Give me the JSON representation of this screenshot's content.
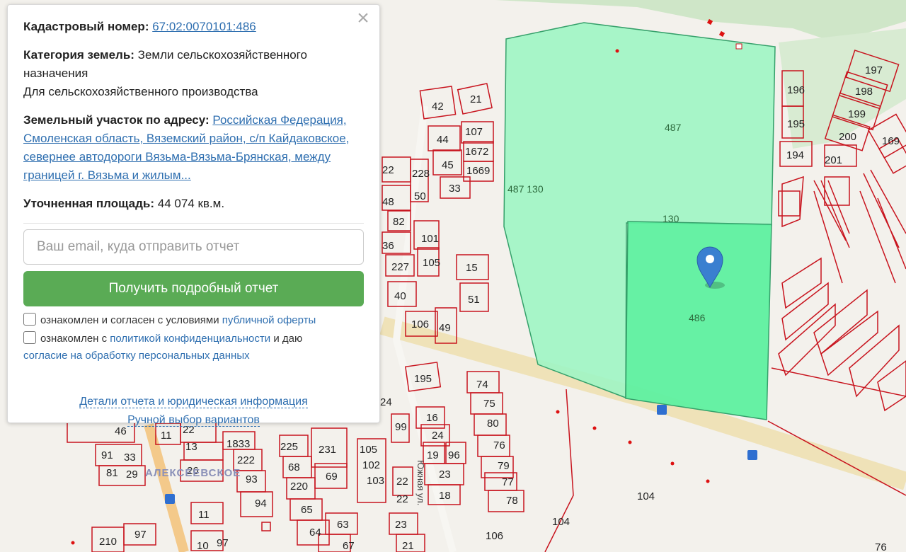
{
  "panel": {
    "close_label": "×",
    "cadastral_label": "Кадастровый номер:",
    "cadastral_value": "67:02:0070101:486",
    "category_label": "Категория земель:",
    "category_value": "Земли сельскохозяйственного назначения",
    "usage": "Для сельскохозяйственного производства",
    "address_label": "Земельный участок по адресу:",
    "address_value": "Российская Федерация, Смоленская область, Вяземский район, с/п Кайдаковское, севернее автодороги Вязьма-Вязьма-Брянская, между границей г. Вязьма и жилым...",
    "area_label": "Уточненная площадь:",
    "area_value": "44 074 кв.м.",
    "email_placeholder": "Ваш email, куда отправить отчет",
    "submit_label": "Получить подробный отчет",
    "check1_text": "ознакомлен и согласен с условиями",
    "check1_link": "публичной оферты",
    "check2_text": "ознакомлен с",
    "check2_link": "политикой конфиденциальности",
    "check2_text2": "и даю",
    "check2_link2": "согласие на обработку персональных данных",
    "footer_link1": "Детали отчета и юридическая информация",
    "footer_link2": "Ручной выбор вариантов"
  },
  "map": {
    "selected_parcel": "486",
    "neighbor_parcel": "487",
    "neighbor_labels": [
      "487 130",
      "130"
    ],
    "selected_color": "#5ef0a0",
    "neighbor_color": "#9ef5c4",
    "boundary_color": "#c8141e",
    "village_label": "АЛЕКСЕЕВСКОЕ",
    "street_labels": [
      "Южная ул."
    ],
    "parcel_numbers": [
      "42",
      "21",
      "44",
      "107",
      "1672",
      "45",
      "1669",
      "33",
      "22",
      "228",
      "50",
      "48",
      "82",
      "36",
      "101",
      "227",
      "105",
      "15",
      "40",
      "51",
      "106",
      "49",
      "195",
      "74",
      "75",
      "80",
      "76",
      "79",
      "77",
      "78",
      "16",
      "24",
      "99",
      "19",
      "96",
      "23",
      "18",
      "22",
      "46",
      "11",
      "22",
      "13",
      "1833",
      "225",
      "231",
      "91",
      "33",
      "81",
      "29",
      "26",
      "222",
      "93",
      "68",
      "220",
      "69",
      "94",
      "65",
      "105",
      "102",
      "103",
      "22",
      "11",
      "63",
      "64",
      "67",
      "23",
      "21",
      "210",
      "97",
      "10",
      "97",
      "106",
      "104",
      "104",
      "197",
      "196",
      "198",
      "195",
      "199",
      "200",
      "194",
      "201",
      "169",
      "24",
      "76"
    ]
  }
}
